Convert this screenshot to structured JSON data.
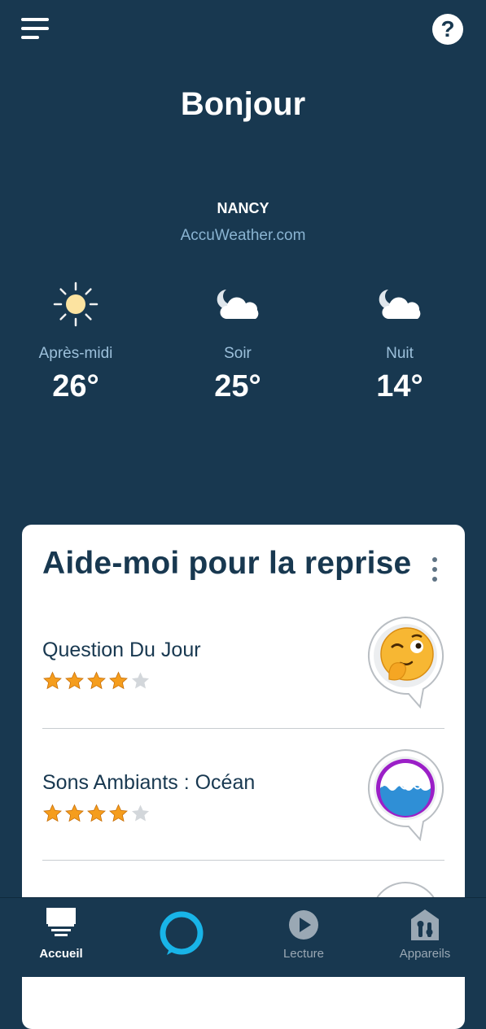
{
  "header": {
    "menu_icon": "hamburger-menu-icon",
    "help_icon": "question-mark-icon",
    "help_symbol": "?"
  },
  "greeting": "Bonjour",
  "weather": {
    "city": "NANCY",
    "provider": "AccuWeather.com",
    "forecasts": [
      {
        "period": "Après-midi",
        "temp": "26°",
        "icon": "sun-icon"
      },
      {
        "period": "Soir",
        "temp": "25°",
        "icon": "moon-cloud-icon"
      },
      {
        "period": "Nuit",
        "temp": "14°",
        "icon": "moon-cloud-icon"
      }
    ]
  },
  "card": {
    "title": "Aide-moi pour la reprise",
    "menu_icon": "more-vertical-icon",
    "skills": [
      {
        "name": "Question Du Jour",
        "rating": 4,
        "max_rating": 5,
        "icon": "thinking-emoji-skill-icon"
      },
      {
        "name": "Sons Ambiants : Océan",
        "rating": 4,
        "max_rating": 5,
        "icon": "ocean-waves-skill-icon"
      }
    ]
  },
  "nav": {
    "items": [
      {
        "label": "Accueil",
        "icon": "home-device-icon",
        "active": true
      },
      {
        "label": "",
        "icon": "alexa-ring-icon",
        "active": false
      },
      {
        "label": "Lecture",
        "icon": "play-icon",
        "active": false
      },
      {
        "label": "Appareils",
        "icon": "devices-home-icon",
        "active": false
      }
    ]
  },
  "colors": {
    "background": "#183850",
    "card": "#ffffff",
    "star": "#f59d1d",
    "star_empty": "#d3d7db",
    "alexa": "#18b4e8",
    "link": "#8ab4d2"
  }
}
